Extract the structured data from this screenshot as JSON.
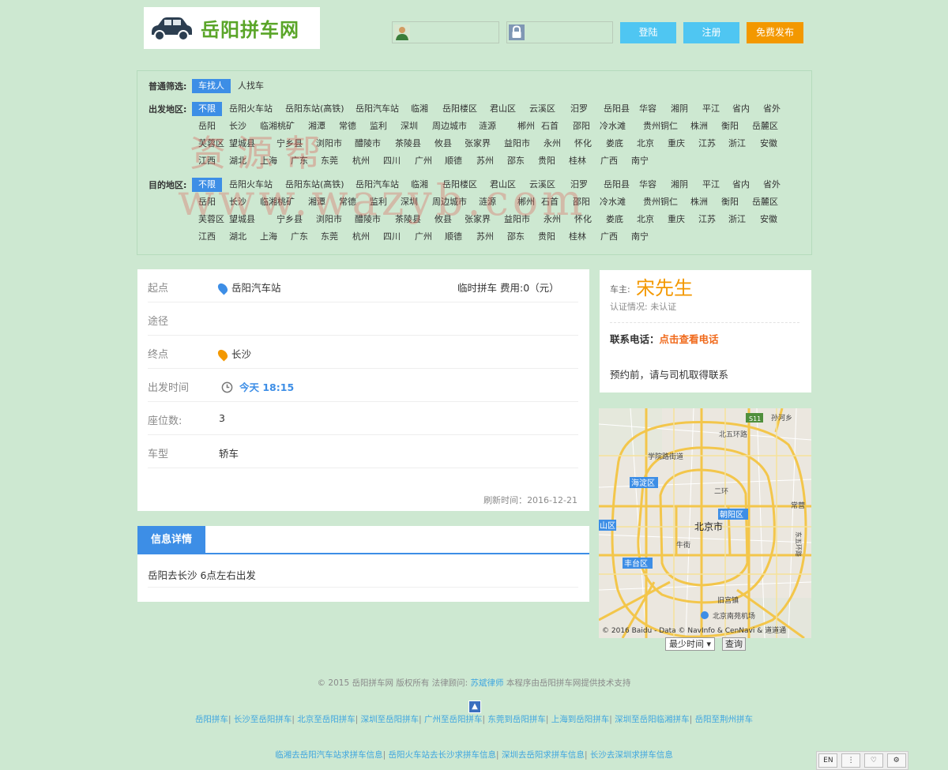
{
  "header": {
    "logo_text": "岳阳拼车网",
    "login_button": "登陆",
    "register_button": "注册",
    "publish_button": "免费发布"
  },
  "filter": {
    "general_label": "普通筛选:",
    "general_options": [
      "车找人",
      "人找车"
    ],
    "depart_label": "出发地区:",
    "dest_label": "目的地区:",
    "regions_row1": [
      "不限",
      "岳阳火车站",
      "岳阳东站(高铁)",
      "岳阳汽车站",
      "临湘",
      "岳阳楼区",
      "君山区",
      "云溪区",
      "汨罗",
      "岳阳县",
      "华容",
      "湘阴",
      "平江",
      "省内",
      "省外"
    ],
    "regions_row2": [
      "岳阳",
      "长沙",
      "临湘桃矿",
      "湘潭",
      "常德",
      "监利",
      "深圳",
      "周边城市",
      "涟源",
      "郴州",
      "石首",
      "邵阳",
      "冷水滩",
      "贵州铜仁",
      "株洲",
      "衡阳",
      "岳麓区"
    ],
    "regions_row3": [
      "芙蓉区",
      "望城县",
      "宁乡县",
      "浏阳市",
      "醴陵市",
      "茶陵县",
      "攸县",
      "张家界",
      "益阳市",
      "永州",
      "怀化",
      "娄底",
      "北京",
      "重庆",
      "江苏",
      "浙江",
      "安徽"
    ],
    "regions_row4": [
      "江西",
      "湖北",
      "上海",
      "广东",
      "东莞",
      "杭州",
      "四川",
      "广州",
      "顺德",
      "苏州",
      "邵东",
      "贵阳",
      "桂林",
      "广西",
      "南宁"
    ]
  },
  "trip": {
    "start_label": "起点",
    "start_value": "岳阳汽车站",
    "trip_type": "临时拼车",
    "fee_label": "费用:",
    "fee_value": "0（元）",
    "via_label": "途径",
    "end_label": "终点",
    "end_value": "长沙",
    "time_label": "出发时间",
    "time_value": "今天 18:15",
    "seats_label": "座位数:",
    "seats_value": "3",
    "car_label": "车型",
    "car_value": "轿车",
    "refresh_label": "刷新时间：",
    "refresh_value": "2016-12-21"
  },
  "owner": {
    "owner_label": "车主:",
    "owner_name": "宋先生",
    "auth_label": "认证情况: 未认证",
    "phone_label": "联系电话：",
    "phone_link": "点击查看电话",
    "note": "预约前，请与司机取得联系"
  },
  "map": {
    "labels": [
      "S11",
      "孙河乡",
      "北五环路",
      "学院路街道",
      "海淀区",
      "二环",
      "常营",
      "朝阳区",
      "北京市",
      "山区",
      "牛街",
      "东五环路",
      "丰台区",
      "旧宫镇",
      "北京南苑机场",
      "北五环路"
    ],
    "copyright": "© 2016 Baidu - Data © NavInfo & CenNavi & 道道通",
    "route_select": "最少时间",
    "query_button": "查询"
  },
  "detail": {
    "tab_label": "信息详情",
    "content": "岳阳去长沙 6点左右出发"
  },
  "footer": {
    "copyright": "© 2015 岳阳拼车网 版权所有 法律顾问:",
    "lawyer": "苏斌律师",
    "support": "本程序由岳阳拼车网提供技术支持",
    "links_row1": [
      "岳阳拼车",
      "长沙至岳阳拼车",
      "北京至岳阳拼车",
      "深圳至岳阳拼车",
      "广州至岳阳拼车",
      "东莞到岳阳拼车",
      "上海到岳阳拼车",
      "深圳至岳阳临湘拼车",
      "岳阳至荆州拼车"
    ],
    "links_row2": [
      "临湘去岳阳汽车站求拼车信息",
      "岳阳火车站去长沙求拼车信息",
      "深圳去岳阳求拼车信息",
      "长沙去深圳求拼车信息"
    ]
  },
  "toolbar": {
    "lang": "EN"
  },
  "watermark": {
    "line1": "资源帮",
    "line2": "www.wazyb.com"
  },
  "colors": {
    "accent": "#3d8ee6",
    "orange": "#f39800",
    "cyan": "#4fc6f2",
    "bg": "#cde8d1"
  }
}
